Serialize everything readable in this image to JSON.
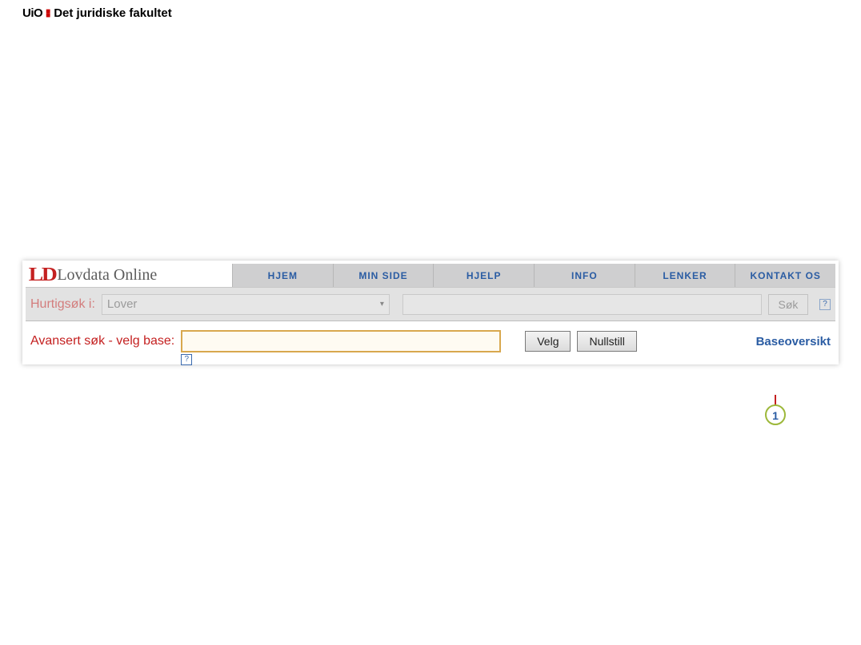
{
  "header": {
    "uio_logo": "UiO",
    "uio_faculty": "Det juridiske fakultet"
  },
  "brand": {
    "mark": "LD",
    "text": "Lovdata Online"
  },
  "nav": {
    "items": [
      "HJEM",
      "MIN SIDE",
      "HJELP",
      "INFO",
      "LENKER",
      "KONTAKT OS"
    ]
  },
  "quicksearch": {
    "label": "Hurtigsøk i:",
    "selected": "Lover",
    "search_label": "Søk",
    "help_label": "?"
  },
  "advsearch": {
    "label": "Avansert søk - velg base:",
    "velg_label": "Velg",
    "nullstill_label": "Nullstill",
    "link_label": "Baseoversikt",
    "help_label": "?"
  },
  "callout": {
    "number": "1"
  }
}
